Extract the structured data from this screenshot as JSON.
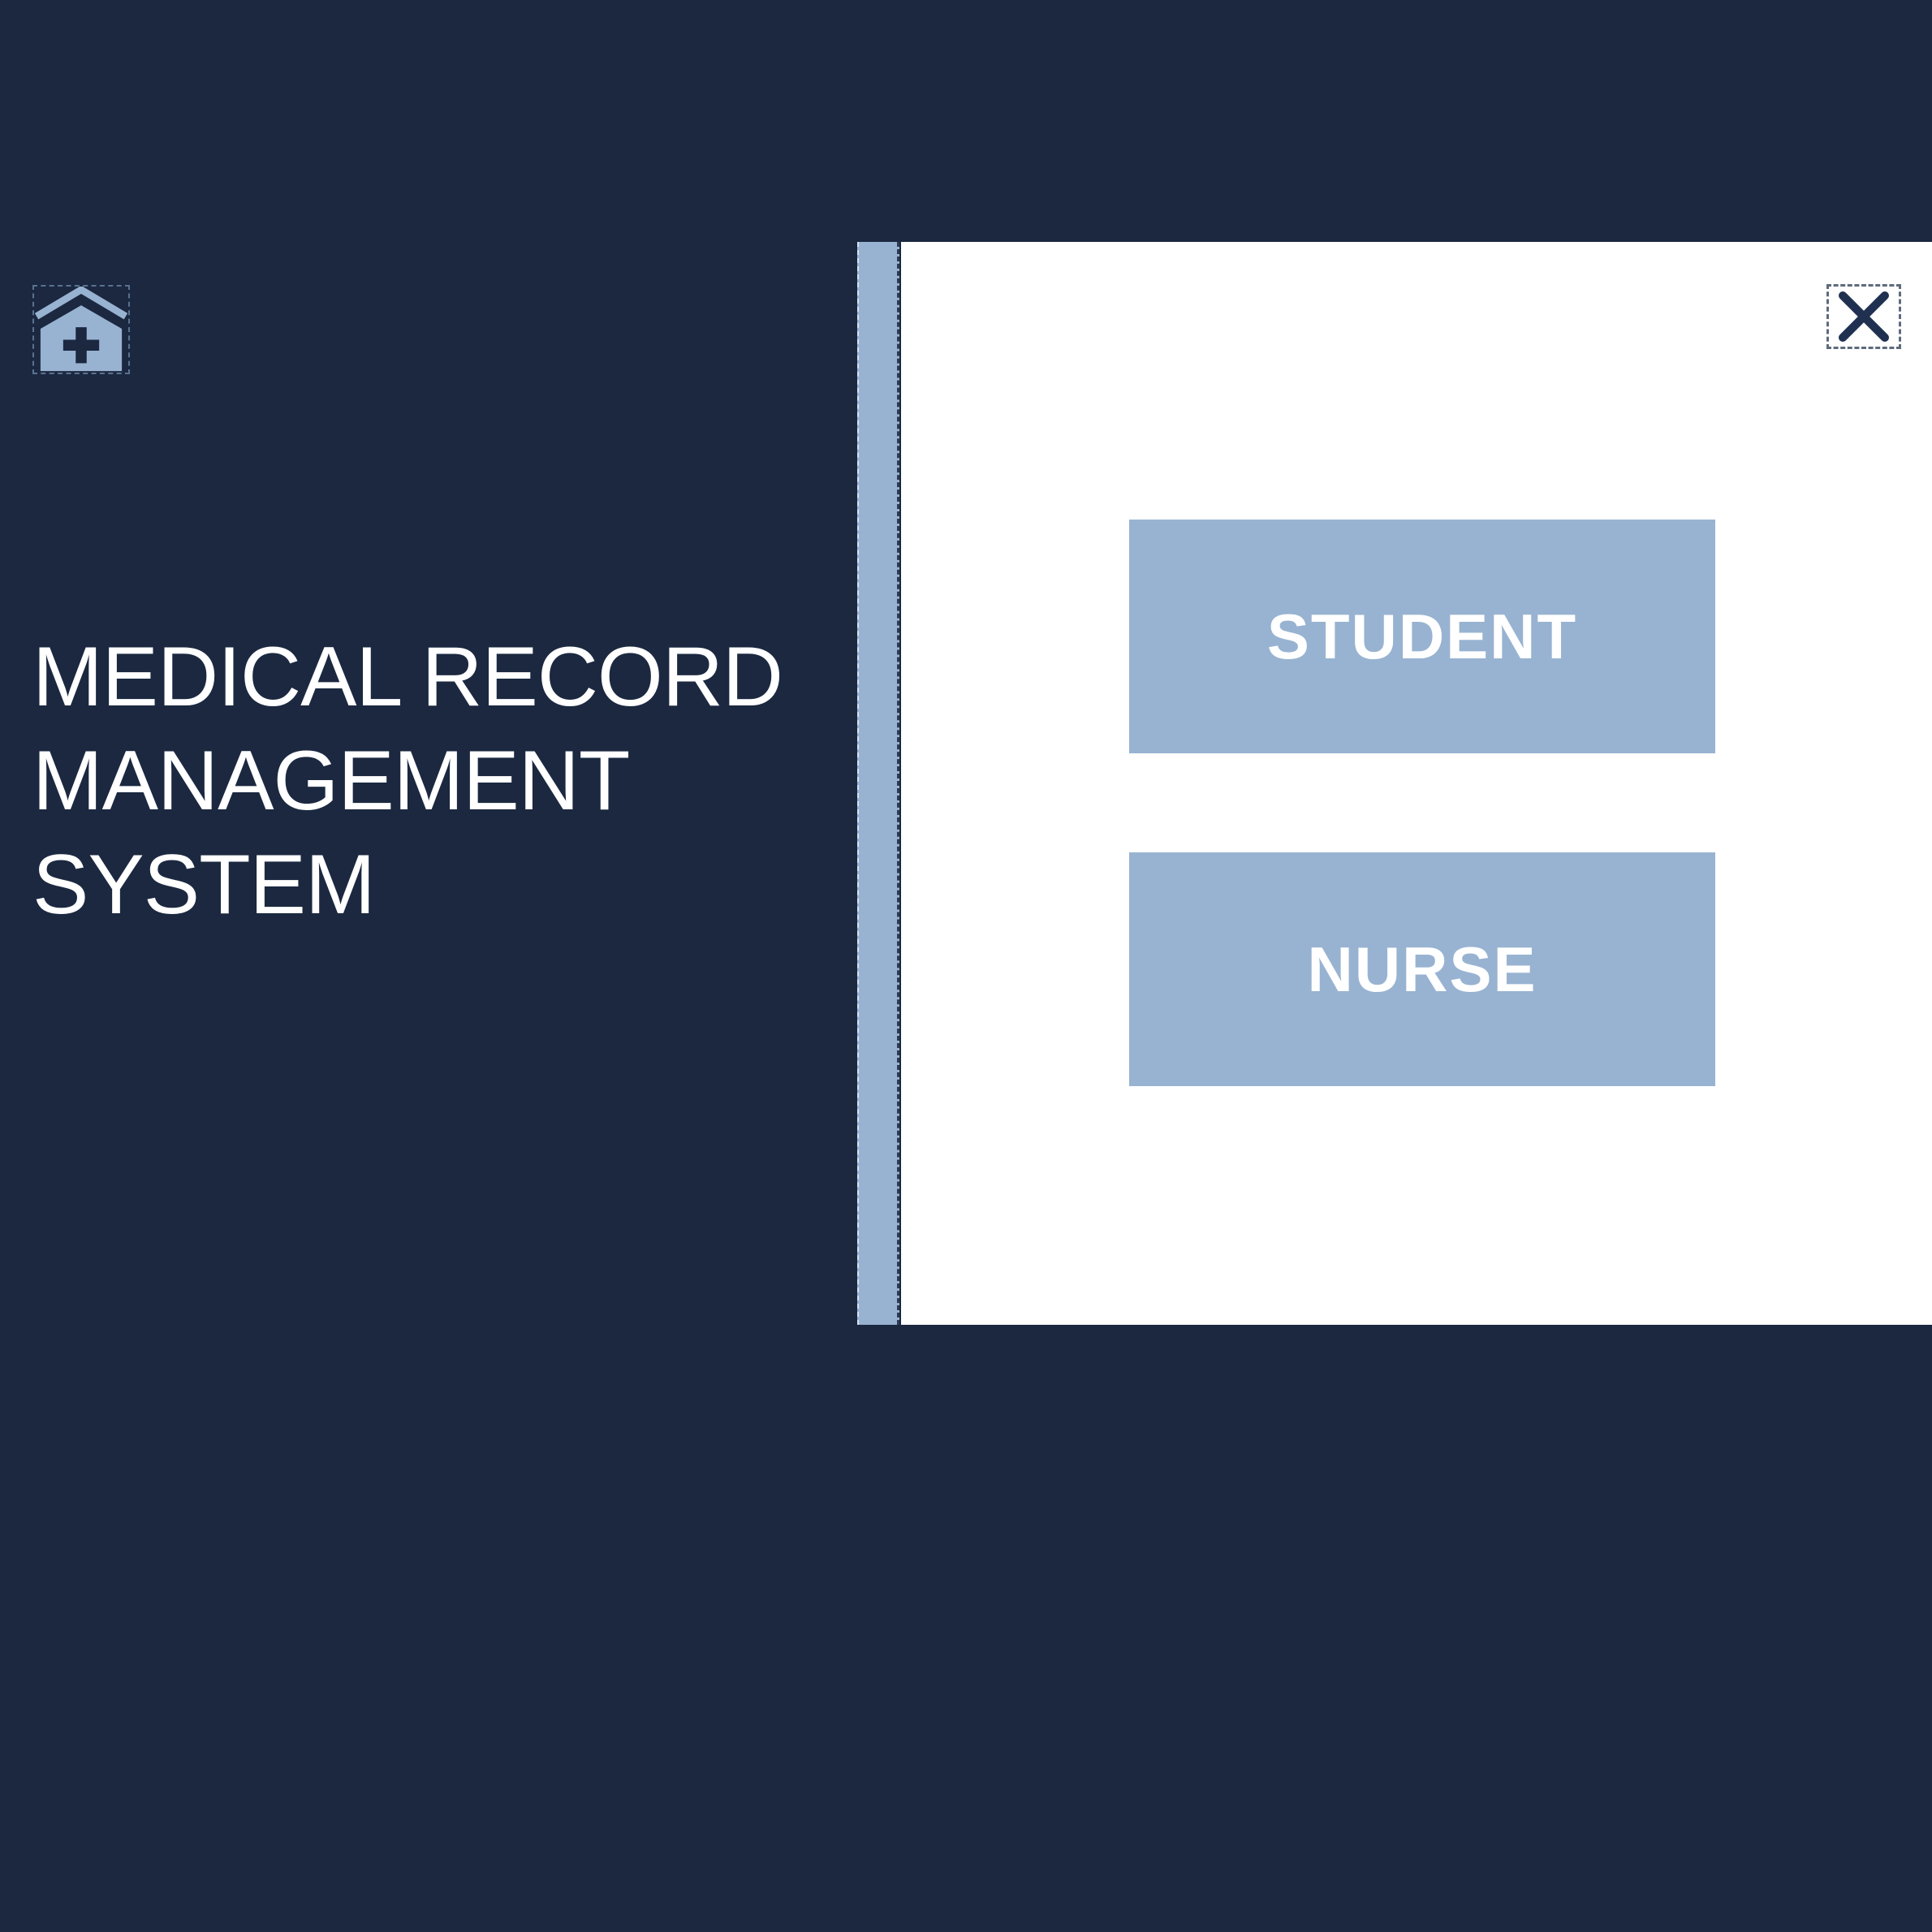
{
  "app": {
    "title_lines": [
      "MEDICAL RECORD",
      "MANAGEMENT",
      "SYSTEM"
    ],
    "logo_icon": "hospital-house-cross-icon"
  },
  "login_panel": {
    "close_icon": "close-x-icon",
    "role_buttons": {
      "student_label": "STUDENT",
      "nurse_label": "NURSE"
    }
  },
  "colors": {
    "background": "#1b2840",
    "accent": "#98b3d1",
    "panel": "#ffffff",
    "text_light": "#ffffff",
    "icon_dark": "#1f3050"
  }
}
